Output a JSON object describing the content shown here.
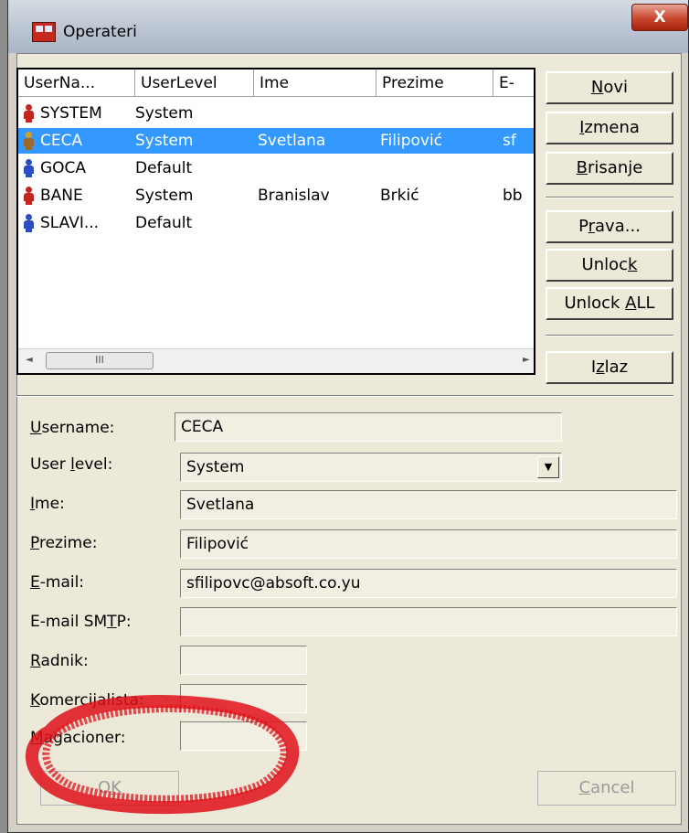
{
  "window": {
    "title": "Operateri",
    "close_label": "X"
  },
  "list": {
    "columns": [
      {
        "label": "UserNa..."
      },
      {
        "label": "UserLevel"
      },
      {
        "label": "Ime"
      },
      {
        "label": "Prezime"
      },
      {
        "label": "E-"
      }
    ],
    "rows": [
      {
        "username": "SYSTEM",
        "level": "System",
        "ime": "",
        "prezime": "",
        "email": "",
        "icon": "user-red-icon",
        "selected": false
      },
      {
        "username": "CECA",
        "level": "System",
        "ime": "Svetlana",
        "prezime": "Filipović",
        "email": "sf",
        "icon": "user-gold-icon",
        "selected": true
      },
      {
        "username": "GOCA",
        "level": "Default",
        "ime": "",
        "prezime": "",
        "email": "",
        "icon": "user-blue-icon",
        "selected": false
      },
      {
        "username": "BANE",
        "level": "System",
        "ime": "Branislav",
        "prezime": "Brkić",
        "email": "bb",
        "icon": "user-red-icon",
        "selected": false
      },
      {
        "username": "SLAVI...",
        "level": "Default",
        "ime": "",
        "prezime": "",
        "email": "",
        "icon": "user-blue-icon",
        "selected": false
      }
    ],
    "scroll_left": "◄",
    "scroll_thumb": "III",
    "scroll_right": "►"
  },
  "buttons": {
    "novi": {
      "a": "",
      "u": "N",
      "b": "ovi"
    },
    "izmena": {
      "a": "",
      "u": "I",
      "b": "zmena"
    },
    "brisanje": {
      "a": "",
      "u": "B",
      "b": "risanje"
    },
    "prava": {
      "a": "P",
      "u": "r",
      "b": "ava..."
    },
    "unlock": {
      "a": "Unloc",
      "u": "k",
      "b": ""
    },
    "unlock_all": {
      "a": "Unlock ",
      "u": "A",
      "b": "LL"
    },
    "izlaz": {
      "a": "I",
      "u": "z",
      "b": "laz"
    }
  },
  "form": {
    "username": {
      "a": "",
      "u": "U",
      "b": "sername:",
      "value": "CECA"
    },
    "user_level": {
      "a": "User ",
      "u": "l",
      "b": "evel:",
      "value": "System",
      "arrow": "▼"
    },
    "ime": {
      "a": "",
      "u": "I",
      "b": "me:",
      "value": "Svetlana"
    },
    "prezime": {
      "a": "",
      "u": "P",
      "b": "rezime:",
      "value": "Filipović"
    },
    "email": {
      "a": "",
      "u": "E",
      "b": "-mail:",
      "value": "sfilipovc@absoft.co.yu"
    },
    "email_smtp": {
      "a": "E-mail SM",
      "u": "T",
      "b": "P:",
      "value": ""
    },
    "radnik": {
      "a": "",
      "u": "R",
      "b": "adnik:",
      "value": ""
    },
    "komercijalista": {
      "a": "",
      "u": "K",
      "b": "omercijalista:",
      "value": ""
    },
    "magacioner": {
      "a": "",
      "u": "M",
      "b": "agacioner:",
      "value": ""
    }
  },
  "footer": {
    "ok": {
      "a": "O",
      "u": "K",
      "b": ""
    },
    "cancel": {
      "a": "",
      "u": "C",
      "b": "ancel"
    }
  },
  "colors": {
    "selection": "#3399ff",
    "annotation": "#e0101a"
  }
}
